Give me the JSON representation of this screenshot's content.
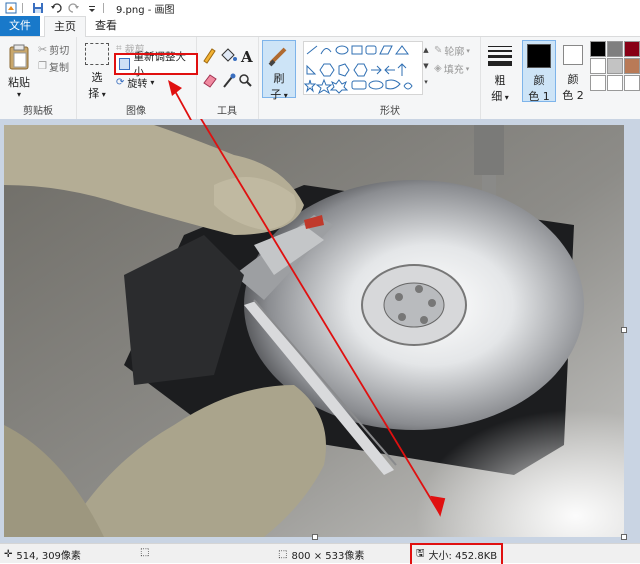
{
  "window": {
    "title": "9.png - 画图"
  },
  "tabs": {
    "file": "文件",
    "home": "主页",
    "view": "查看"
  },
  "clipboard": {
    "paste": "粘贴",
    "cut": "剪切",
    "copy": "复制",
    "group": "剪贴板"
  },
  "image": {
    "select": "选",
    "select2": "择",
    "crop": "裁剪",
    "resize": "重新调整大小",
    "rotate": "旋转",
    "group": "图像"
  },
  "tools": {
    "group": "工具"
  },
  "brush": {
    "label1": "刷",
    "label2": "子"
  },
  "shapes": {
    "outline": "轮廓",
    "fill": "填充",
    "group": "形状"
  },
  "size": {
    "label1": "粗",
    "label2": "细"
  },
  "colors": {
    "color1_a": "颜",
    "color1_b": "色 1",
    "color2_a": "颜",
    "color2_b": "色 2",
    "palette": [
      "#000000",
      "#7f7f7f",
      "#880015",
      "#ed1c24",
      "#ffffff",
      "#c3c3c3",
      "#b97a57",
      "#ffaec9"
    ]
  },
  "status": {
    "cursor": "514, 309像素",
    "dimensions": "800 × 533像素",
    "filesize": "大小: 452.8KB"
  }
}
